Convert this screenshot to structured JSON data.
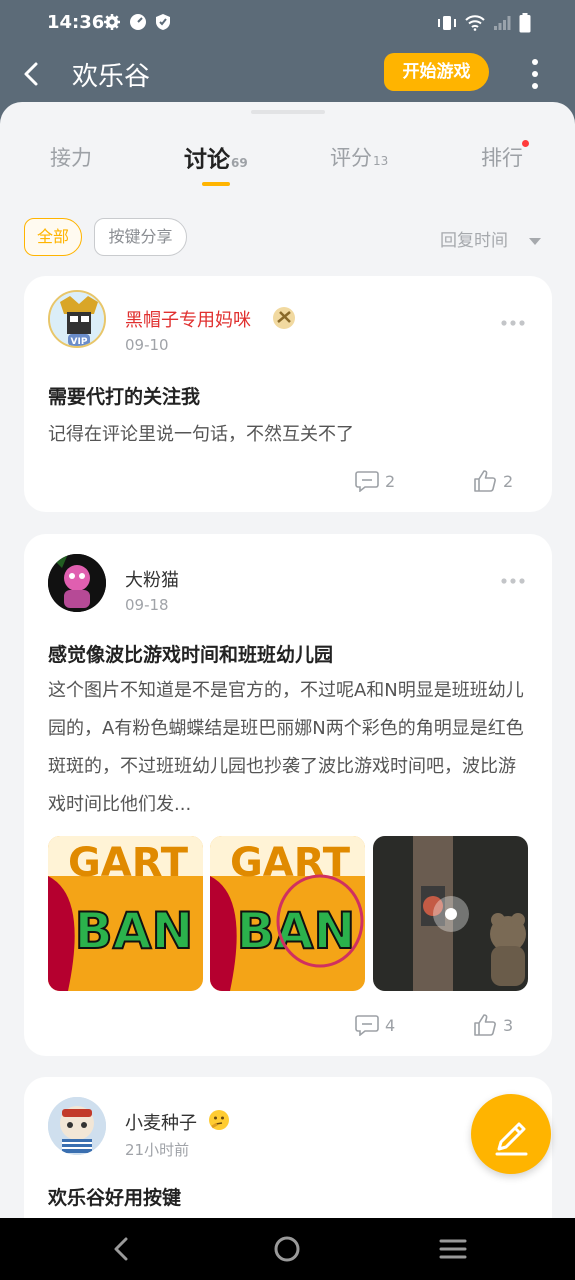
{
  "status": {
    "time": "14:36"
  },
  "appbar": {
    "title": "欢乐谷",
    "start_label": "开始游戏"
  },
  "tabs": [
    {
      "label": "接力",
      "count": ""
    },
    {
      "label": "讨论",
      "count": "69",
      "active": true
    },
    {
      "label": "评分",
      "count": "13"
    },
    {
      "label": "排行",
      "count": "",
      "badge": true
    }
  ],
  "filters": {
    "all": "全部",
    "share": "按键分享",
    "sort": "回复时间"
  },
  "posts": [
    {
      "user": "黑帽子专用妈咪",
      "date": "09-10",
      "title": "需要代打的关注我",
      "body": "记得在评论里说一句话，不然互关不了",
      "comments": "2",
      "likes": "2"
    },
    {
      "user": "大粉猫",
      "date": "09-18",
      "title": "感觉像波比游戏时间和班班幼儿园",
      "body": "这个图片不知道是不是官方的，不过呢A和N明显是班班幼儿园的，A有粉色蝴蝶结是班巴丽娜N两个彩色的角明显是红色斑斑的，不过班班幼儿园也抄袭了波比游戏时间吧，波比游戏时间比他们发...",
      "comments": "4",
      "likes": "3",
      "image_text": [
        "GART",
        "BAN"
      ]
    },
    {
      "user": "小麦种子",
      "date": "21小时前",
      "title": "欢乐谷好用按键"
    }
  ],
  "colors": {
    "accent": "#ffb400",
    "header": "#5c6b78",
    "page": "#f3f4f6",
    "username_red": "#e0302f"
  }
}
